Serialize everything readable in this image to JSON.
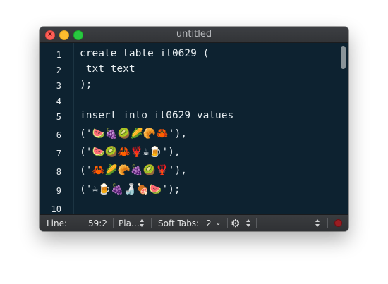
{
  "window": {
    "title": "untitled"
  },
  "editor": {
    "line_numbers": [
      "1",
      "2",
      "3",
      "4",
      "5",
      "6",
      "7",
      "8",
      "9",
      "10"
    ],
    "lines": [
      "create table it0629 (",
      " txt text",
      ");",
      "",
      "insert into it0629 values",
      "('🍉🍇🥝🌽🥐🦀'),",
      "('🍉🥝🦀🦞☕🍺'),",
      "('🦀🌽🥐🍇🥝🦞'),",
      "('☕🍺🍇🍶🍖🍉');"
    ]
  },
  "statusbar": {
    "line_label": "Line:",
    "position": "59:2",
    "syntax": "Pla…",
    "tabs_label": "Soft Tabs:",
    "tab_size": "2",
    "record_color": "#9a1d22"
  }
}
